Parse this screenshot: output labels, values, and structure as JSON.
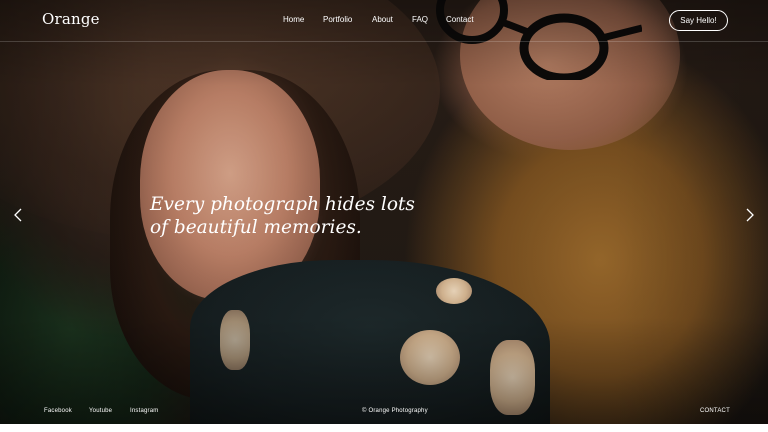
{
  "brand": {
    "logo": "Orange"
  },
  "nav": {
    "items": [
      {
        "label": "Home"
      },
      {
        "label": "Portfolio"
      },
      {
        "label": "About"
      },
      {
        "label": "FAQ"
      },
      {
        "label": "Contact"
      }
    ],
    "cta_label": "Say Hello!"
  },
  "hero": {
    "headline_line1": "Every photograph hides lots",
    "headline_line2": "of beautiful memories.",
    "prev_icon": "chevron-left-icon",
    "next_icon": "chevron-right-icon"
  },
  "footer": {
    "social": [
      {
        "label": "Facebook"
      },
      {
        "label": "Youtube"
      },
      {
        "label": "Instagram"
      }
    ],
    "copyright": "© Orange Photography",
    "contact_label": "CONTACT"
  },
  "colors": {
    "text": "#ffffff",
    "background": "#1a1410"
  }
}
